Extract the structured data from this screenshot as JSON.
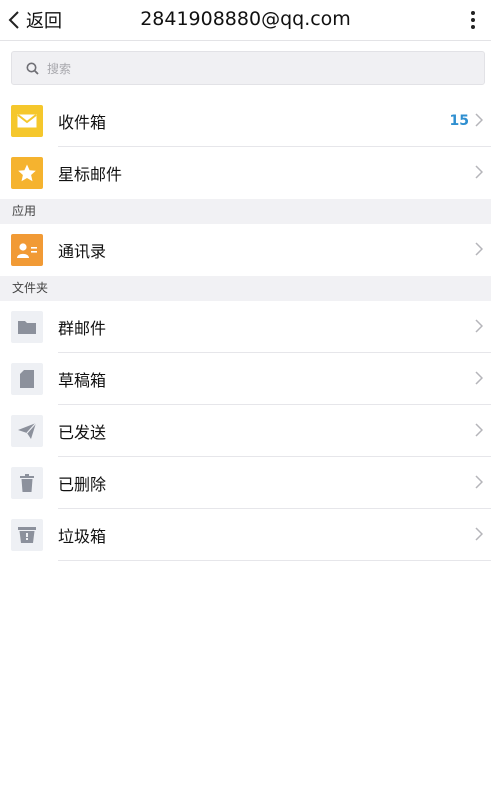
{
  "header": {
    "back_label": "返回",
    "title": "2841908880@qq.com"
  },
  "search": {
    "placeholder": "搜索"
  },
  "mailboxes": [
    {
      "label": "收件箱",
      "badge": "15",
      "icon": "inbox-icon"
    },
    {
      "label": "星标邮件",
      "badge": "",
      "icon": "star-icon"
    }
  ],
  "sections": {
    "apps": "应用",
    "folders": "文件夹"
  },
  "apps": [
    {
      "label": "通讯录",
      "icon": "contacts-icon"
    }
  ],
  "folders": [
    {
      "label": "群邮件",
      "icon": "folder-icon"
    },
    {
      "label": "草稿箱",
      "icon": "draft-icon"
    },
    {
      "label": "已发送",
      "icon": "send-icon"
    },
    {
      "label": "已删除",
      "icon": "trash-icon"
    },
    {
      "label": "垃圾箱",
      "icon": "spam-bin-icon"
    }
  ],
  "colors": {
    "inbox": "#f5c72c",
    "star": "#f5b32f",
    "contacts": "#f19a35",
    "folder_icon_bg": "#eef0f4",
    "folder_icon_fg": "#8c919c",
    "badge": "#2f8fd0"
  }
}
